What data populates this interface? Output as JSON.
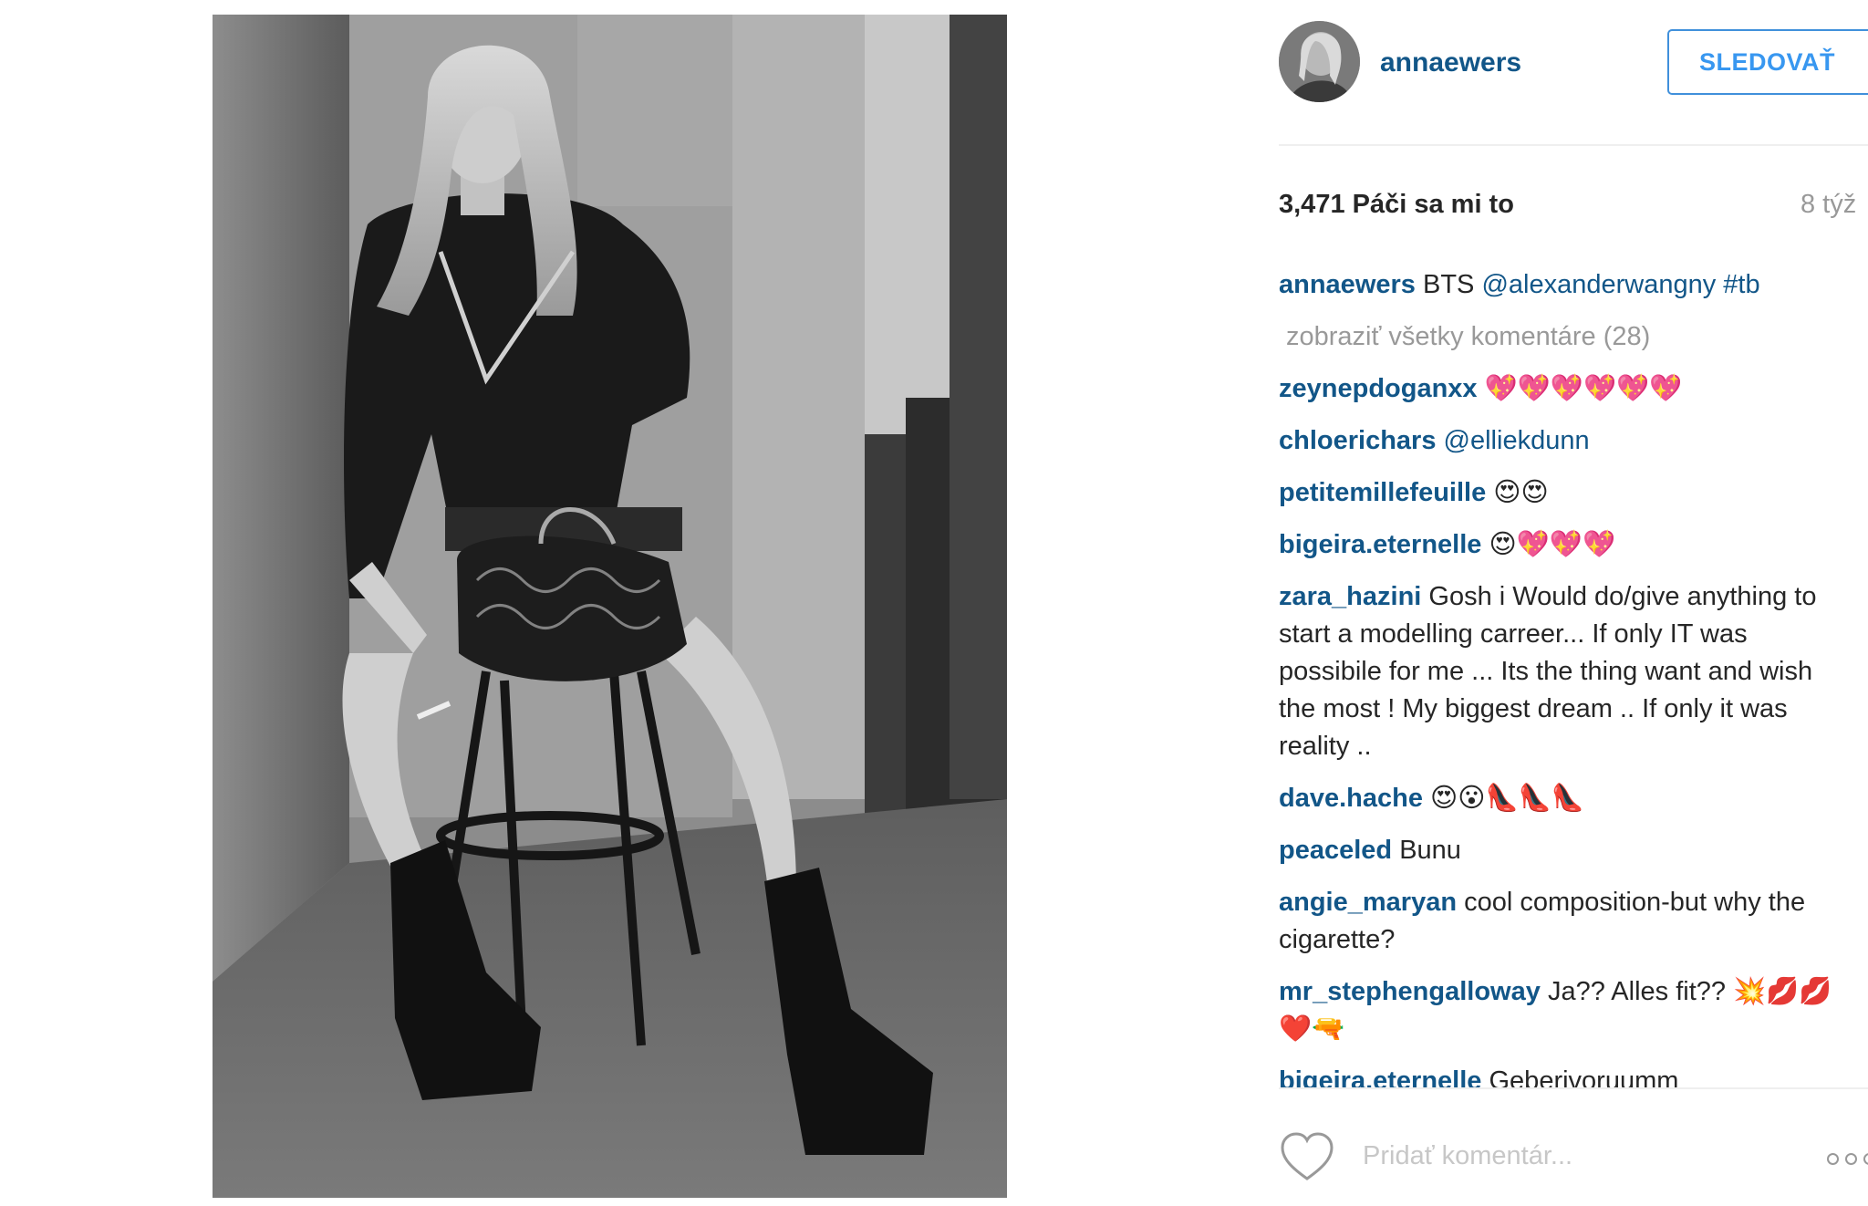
{
  "post": {
    "author": {
      "username": "annaewers",
      "follow_label": "SLEDOVAŤ"
    },
    "likes_text": "3,471 Páči sa mi to",
    "time_ago": "8 týž",
    "caption": {
      "user": "annaewers",
      "text_plain": "BTS ",
      "mention": "@alexanderwangny",
      "hashtag": "#tb"
    },
    "view_all_comments": "zobraziť všetky komentáre (28)",
    "comments": [
      {
        "user": "zeynepdoganxx",
        "text": "💖💖💖💖💖💖"
      },
      {
        "user": "chloerichars",
        "text": "@elliekdunn"
      },
      {
        "user": "petitemillefeuille",
        "text": "😍😍"
      },
      {
        "user": "bigeira.eternelle",
        "text": "😍💖💖💖"
      },
      {
        "user": "zara_hazini",
        "text": "Gosh i Would do/give anything to start a modelling carreer... If only IT was possibile for me ... Its the thing want and wish the most ! My biggest dream .. If only it was reality .."
      },
      {
        "user": "dave.hache",
        "text": "😍😮👠👠👠"
      },
      {
        "user": "peaceled",
        "text": "Bunu"
      },
      {
        "user": "angie_maryan",
        "text": "cool composition-but why the cigarette?"
      },
      {
        "user": "mr_stephengalloway",
        "text": "Ja?? Alles fit?? 💥💋💋❤️🔫"
      },
      {
        "user": "bigeira.eternelle",
        "text": "Geberivoruumm"
      }
    ],
    "comment_placeholder": "Pridať komentár..."
  },
  "icons": {
    "like": "heart-icon",
    "more": "more-options-icon"
  },
  "colors": {
    "link_blue": "#125688",
    "follow_blue": "#3897f0",
    "muted_gray": "#999999",
    "text": "#262626"
  }
}
